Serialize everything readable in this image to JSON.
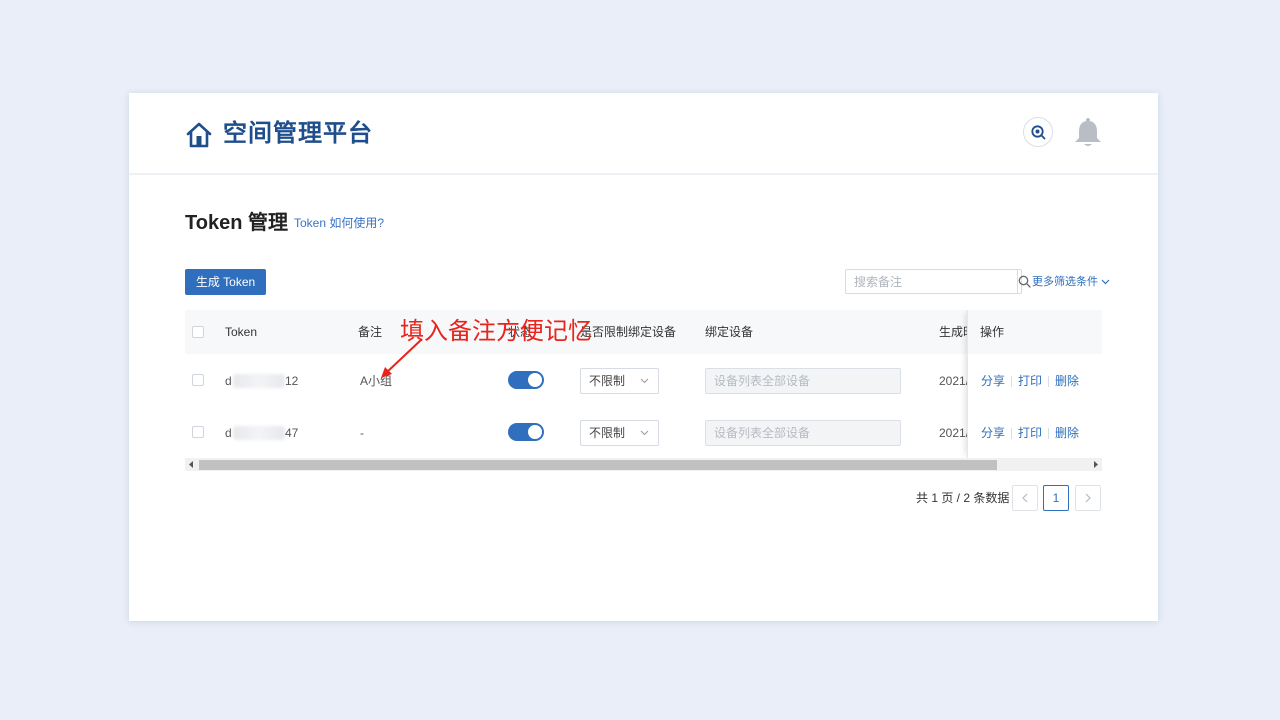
{
  "app": {
    "title": "空间管理平台"
  },
  "page": {
    "title": "Token 管理",
    "help_link": "Token 如何使用?",
    "generate_button": "生成 Token",
    "search_placeholder": "搜索备注",
    "more_filters": "更多筛选条件"
  },
  "table": {
    "headers": {
      "token": "Token",
      "remark": "备注",
      "status": "状态",
      "limit_binding": "是否限制绑定设备",
      "bound_devices": "绑定设备",
      "created": "生成时间",
      "actions": "操作"
    },
    "rows": [
      {
        "token_prefix": "d",
        "token_suffix": "12",
        "remark": "A小组",
        "enabled": true,
        "limit": "不限制",
        "devices_placeholder": "设备列表全部设备",
        "created": "2021/",
        "actions": {
          "share": "分享",
          "print": "打印",
          "delete": "删除"
        }
      },
      {
        "token_prefix": "d",
        "token_suffix": "47",
        "remark": "-",
        "enabled": true,
        "limit": "不限制",
        "devices_placeholder": "设备列表全部设备",
        "created": "2021/",
        "actions": {
          "share": "分享",
          "print": "打印",
          "delete": "删除"
        }
      }
    ]
  },
  "pagination": {
    "info": "共 1 页 / 2 条数据",
    "current_page": "1"
  },
  "annotation": {
    "text": "填入备注方便记忆",
    "color": "#e8241c"
  },
  "colors": {
    "primary": "#2f6fbd",
    "title": "#1f4e8c",
    "background": "#e9eef8"
  },
  "icons": [
    "home-icon",
    "search-icon",
    "bell-icon",
    "chevron-down-icon",
    "chevron-left-icon",
    "chevron-right-icon"
  ]
}
